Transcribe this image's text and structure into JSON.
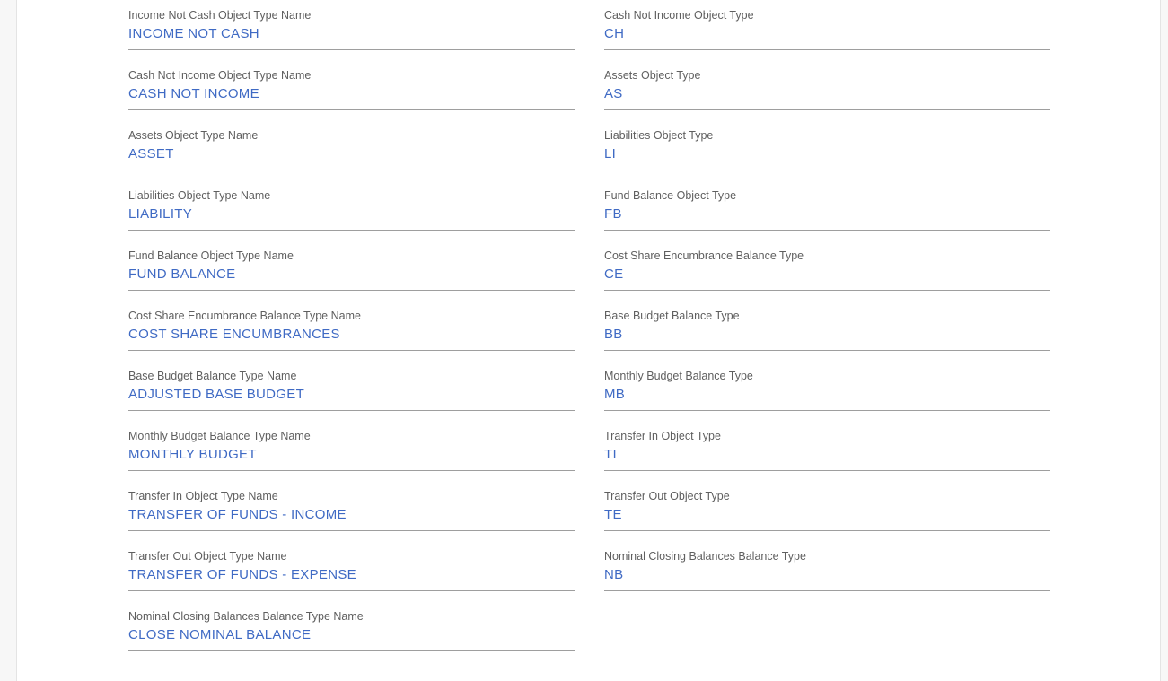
{
  "form": {
    "left_column": [
      {
        "label": "Income Not Cash Object Type Name",
        "value": "INCOME NOT CASH"
      },
      {
        "label": "Cash Not Income Object Type Name",
        "value": "CASH NOT INCOME"
      },
      {
        "label": "Assets Object Type Name",
        "value": "ASSET"
      },
      {
        "label": "Liabilities Object Type Name",
        "value": "LIABILITY"
      },
      {
        "label": "Fund Balance Object Type Name",
        "value": "FUND BALANCE"
      },
      {
        "label": "Cost Share Encumbrance Balance Type Name",
        "value": "COST SHARE ENCUMBRANCES"
      },
      {
        "label": "Base Budget Balance Type Name",
        "value": "ADJUSTED BASE BUDGET"
      },
      {
        "label": "Monthly Budget Balance Type Name",
        "value": "MONTHLY BUDGET"
      },
      {
        "label": "Transfer In Object Type Name",
        "value": "TRANSFER OF FUNDS - INCOME"
      },
      {
        "label": "Transfer Out Object Type Name",
        "value": "TRANSFER OF FUNDS - EXPENSE"
      },
      {
        "label": "Nominal Closing Balances Balance Type Name",
        "value": "CLOSE NOMINAL BALANCE"
      }
    ],
    "right_column": [
      {
        "label": "Cash Not Income Object Type",
        "value": "CH"
      },
      {
        "label": "Assets Object Type",
        "value": "AS"
      },
      {
        "label": "Liabilities Object Type",
        "value": "LI"
      },
      {
        "label": "Fund Balance Object Type",
        "value": "FB"
      },
      {
        "label": "Cost Share Encumbrance Balance Type",
        "value": "CE"
      },
      {
        "label": "Base Budget Balance Type",
        "value": "BB"
      },
      {
        "label": "Monthly Budget Balance Type",
        "value": "MB"
      },
      {
        "label": "Transfer In Object Type",
        "value": "TI"
      },
      {
        "label": "Transfer Out Object Type",
        "value": "TE"
      },
      {
        "label": "Nominal Closing Balances Balance Type",
        "value": "NB"
      }
    ]
  },
  "colors": {
    "label": "#5f5f5f",
    "value": "#3f6ac4",
    "underline": "#9e9e9e"
  }
}
